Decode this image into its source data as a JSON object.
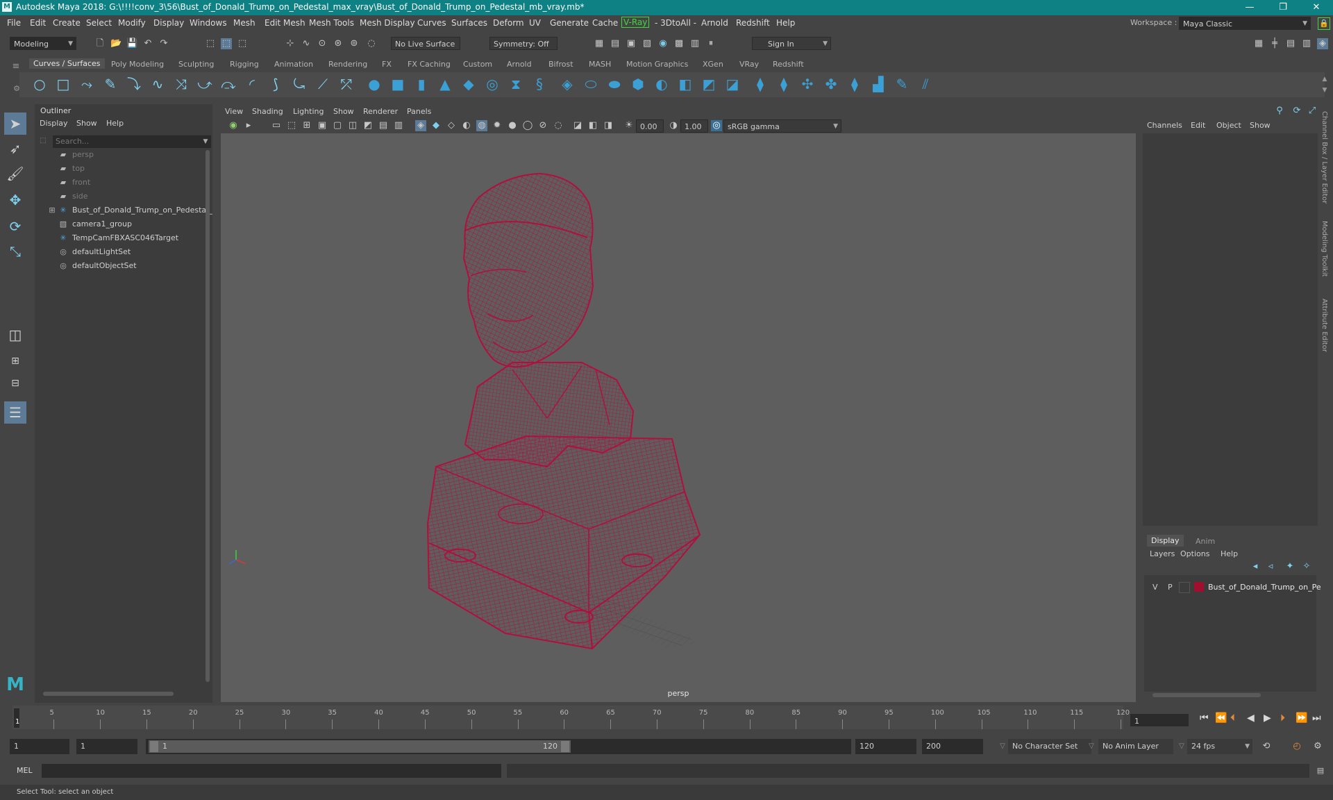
{
  "title_bar": {
    "app_icon": "M",
    "title": "Autodesk Maya 2018: G:\\!!!!conv_3\\56\\Bust_of_Donald_Trump_on_Pedestal_max_vray\\Bust_of_Donald_Trump_on_Pedestal_mb_vray.mb*",
    "minimize": "—",
    "maximize": "❐",
    "close": "✕"
  },
  "menu": [
    "File",
    "Edit",
    "Create",
    "Select",
    "Modify",
    "Display",
    "Windows",
    "Mesh",
    "Edit Mesh",
    "Mesh Tools",
    "Mesh Display",
    "Curves",
    "Surfaces",
    "Deform",
    "UV",
    "Generate",
    "Cache",
    "V-Ray",
    "- 3DtoAll -",
    "Arnold",
    "Redshift",
    "Help"
  ],
  "workspace": {
    "label": "Workspace :",
    "value": "Maya Classic"
  },
  "status_line": {
    "mode": "Modeling",
    "live_surface": "No Live Surface",
    "symmetry": "Symmetry: Off",
    "sign_in": "Sign In"
  },
  "shelf_tabs": [
    "Curves / Surfaces",
    "Poly Modeling",
    "Sculpting",
    "Rigging",
    "Animation",
    "Rendering",
    "FX",
    "FX Caching",
    "Custom",
    "Arnold",
    "Bifrost",
    "MASH",
    "Motion Graphics",
    "XGen",
    "VRay",
    "Redshift"
  ],
  "outliner": {
    "title": "Outliner",
    "menu": [
      "Display",
      "Show",
      "Help"
    ],
    "search_placeholder": "Search...",
    "items": [
      {
        "label": "persp",
        "icon": "camera-icon",
        "dim": true
      },
      {
        "label": "top",
        "icon": "camera-icon",
        "dim": true
      },
      {
        "label": "front",
        "icon": "camera-icon",
        "dim": true
      },
      {
        "label": "side",
        "icon": "camera-icon",
        "dim": true
      },
      {
        "label": "Bust_of_Donald_Trump_on_Pedestal_",
        "icon": "group-icon",
        "dim": false,
        "expandable": true
      },
      {
        "label": "camera1_group",
        "icon": "camera-group-icon",
        "dim": false
      },
      {
        "label": "TempCamFBXASC046Target",
        "icon": "locator-icon",
        "dim": false
      },
      {
        "label": "defaultLightSet",
        "icon": "set-icon",
        "dim": false
      },
      {
        "label": "defaultObjectSet",
        "icon": "set-icon",
        "dim": false
      }
    ]
  },
  "viewport": {
    "menu": [
      "View",
      "Shading",
      "Lighting",
      "Show",
      "Renderer",
      "Panels"
    ],
    "exposure": "0.00",
    "gamma": "1.00",
    "color_space": "sRGB gamma",
    "camera_label": "persp",
    "wire_color": "#b0103e",
    "bg_color": "#5e5e5e"
  },
  "channel_box": {
    "menu": [
      "Channels",
      "Edit",
      "Object",
      "Show"
    ]
  },
  "layer_editor": {
    "tabs": [
      "Display",
      "Anim"
    ],
    "menu": [
      "Layers",
      "Options",
      "Help"
    ],
    "layer": {
      "v": "V",
      "p": "P",
      "name": "Bust_of_Donald_Trump_on_Pe",
      "color": "#a0102e"
    }
  },
  "side_tabs": [
    "Channel Box / Layer Editor",
    "Modeling Toolkit",
    "Attribute Editor"
  ],
  "time_slider": {
    "ticks": [
      "5",
      "10",
      "15",
      "20",
      "25",
      "30",
      "35",
      "40",
      "45",
      "50",
      "55",
      "60",
      "65",
      "70",
      "75",
      "80",
      "85",
      "90",
      "95",
      "100",
      "105",
      "110",
      "115",
      "120"
    ],
    "start_marker": "1",
    "current_frame": "1"
  },
  "range_slider": {
    "start": "1",
    "anim_start": "1",
    "range_start": "1",
    "range_end": "120",
    "anim_end": "120",
    "end": "200",
    "character_set": "No Character Set",
    "anim_layer": "No Anim Layer",
    "fps": "24 fps"
  },
  "command_line": {
    "label": "MEL"
  },
  "help_line": "Select Tool: select an object"
}
